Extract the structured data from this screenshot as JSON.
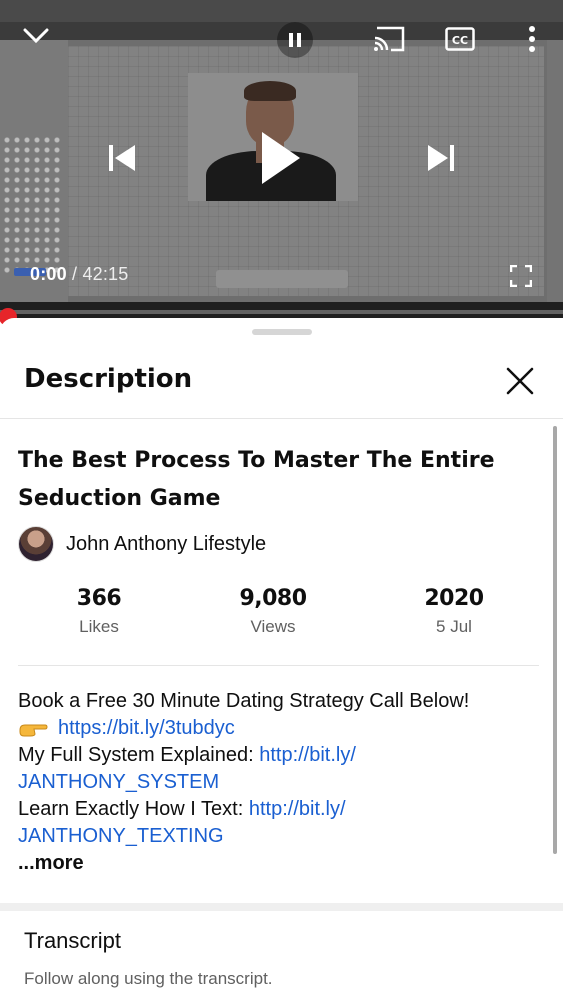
{
  "player": {
    "current_time": "0:00",
    "duration": "42:15",
    "separator": "/",
    "progress": 0
  },
  "description_panel": {
    "title": "Description",
    "video_title": "The Best Process To Master The Entire Seduction Game",
    "channel_name": "John Anthony Lifestyle",
    "stats": [
      {
        "value": "366",
        "label": "Likes"
      },
      {
        "value": "9,080",
        "label": "Views"
      },
      {
        "value": "2020",
        "label": "5 Jul"
      }
    ],
    "description": {
      "line1": "Book a Free 30 Minute Dating Strategy Call Below!",
      "link1": "https://bit.ly/3tubdyc",
      "line3_text": "My Full System Explained: ",
      "link2_part1": "http://bit.ly/",
      "link2_part2": "JANTHONY_SYSTEM",
      "line5_text": "Learn Exactly How I Text: ",
      "link3_part1": "http://bit.ly/",
      "link3_part2": "JANTHONY_TEXTING",
      "more": "...more"
    },
    "transcript": {
      "title": "Transcript",
      "subtitle": "Follow along using the transcript."
    }
  },
  "colors": {
    "link": "#1a5fd1",
    "progress": "#e6252a"
  },
  "icons": [
    "chevron-down-icon",
    "pause-icon",
    "cast-icon",
    "cc-icon",
    "more-vert-icon",
    "previous-icon",
    "play-icon",
    "next-icon",
    "fullscreen-icon",
    "close-icon",
    "pointing-hand-icon"
  ]
}
